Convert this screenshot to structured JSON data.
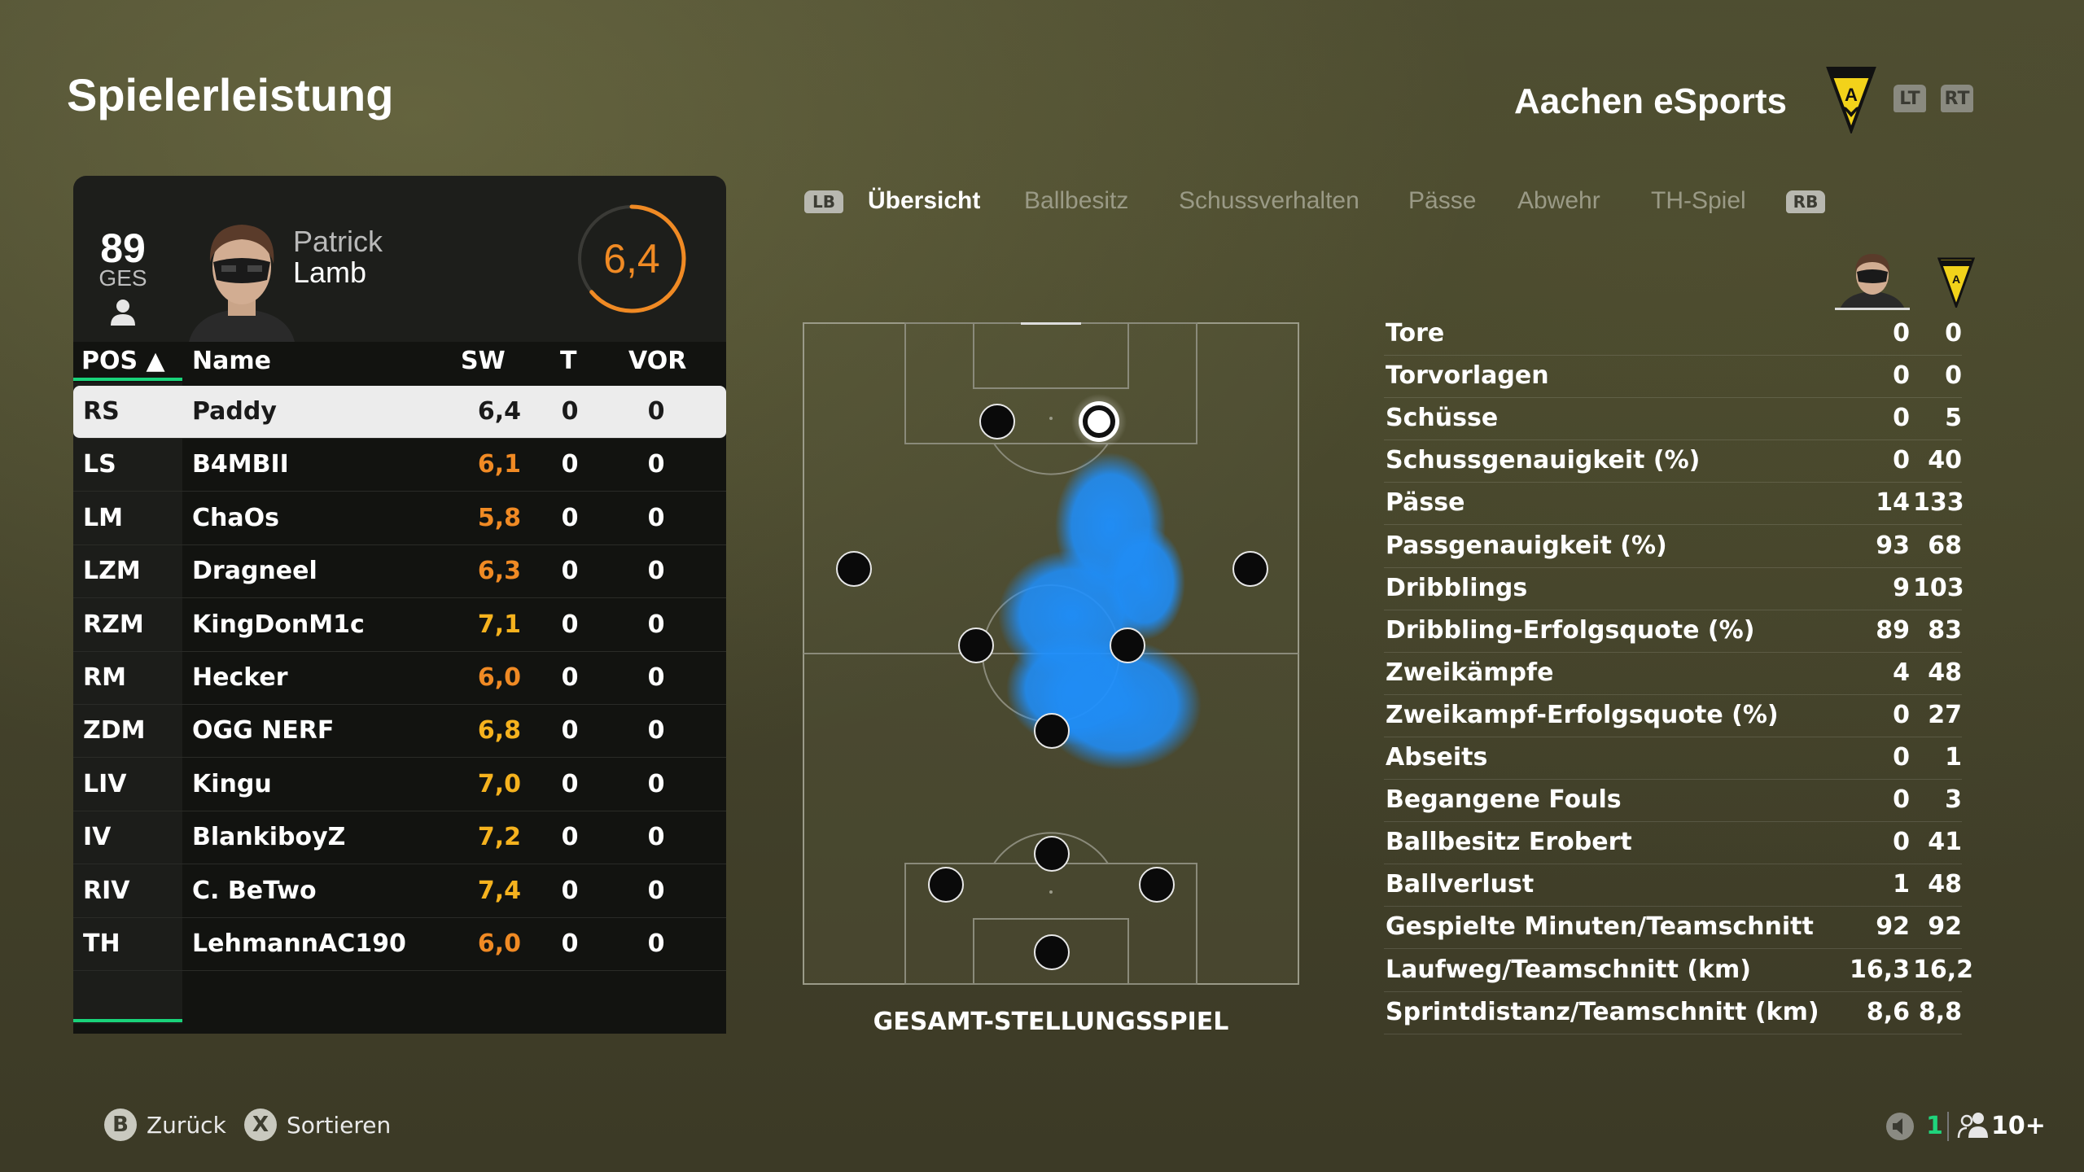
{
  "header": {
    "title": "Spielerleistung",
    "team_name": "Aachen eSports",
    "trigger_left": "LT",
    "trigger_right": "RT"
  },
  "player_card": {
    "overall": "89",
    "overall_label": "GES",
    "first_name": "Patrick",
    "last_name": "Lamb",
    "rating": "6,4"
  },
  "table": {
    "headers": {
      "pos": "POS ▲",
      "name": "Name",
      "sw": "SW",
      "t": "T",
      "vor": "VOR"
    },
    "rows": [
      {
        "pos": "RS",
        "name": "Paddy",
        "sw": "6,4",
        "t": "0",
        "vor": "0"
      },
      {
        "pos": "LS",
        "name": "B4MBII",
        "sw": "6,1",
        "t": "0",
        "vor": "0"
      },
      {
        "pos": "LM",
        "name": "ChaOs",
        "sw": "5,8",
        "t": "0",
        "vor": "0"
      },
      {
        "pos": "LZM",
        "name": "Dragneel",
        "sw": "6,3",
        "t": "0",
        "vor": "0"
      },
      {
        "pos": "RZM",
        "name": "KingDonM1c",
        "sw": "7,1",
        "t": "0",
        "vor": "0"
      },
      {
        "pos": "RM",
        "name": "Hecker",
        "sw": "6,0",
        "t": "0",
        "vor": "0"
      },
      {
        "pos": "ZDM",
        "name": "OGG NERF",
        "sw": "6,8",
        "t": "0",
        "vor": "0"
      },
      {
        "pos": "LIV",
        "name": "Kingu",
        "sw": "7,0",
        "t": "0",
        "vor": "0"
      },
      {
        "pos": "IV",
        "name": "BlankiboyZ",
        "sw": "7,2",
        "t": "0",
        "vor": "0"
      },
      {
        "pos": "RIV",
        "name": "C. BeTwo",
        "sw": "7,4",
        "t": "0",
        "vor": "0"
      },
      {
        "pos": "TH",
        "name": "LehmannAC190",
        "sw": "6,0",
        "t": "0",
        "vor": "0"
      }
    ]
  },
  "tabs": {
    "bumper_left": "LB",
    "bumper_right": "RB",
    "items": [
      "Übersicht",
      "Ballbesitz",
      "Schussverhalten",
      "Pässe",
      "Abwehr",
      "TH-Spiel"
    ],
    "active": "Übersicht"
  },
  "pitch": {
    "caption": "GESAMT-STELLUNGSSPIEL"
  },
  "stats": [
    {
      "label": "Tore",
      "player": "0",
      "team": "0"
    },
    {
      "label": "Torvorlagen",
      "player": "0",
      "team": "0"
    },
    {
      "label": "Schüsse",
      "player": "0",
      "team": "5"
    },
    {
      "label": "Schussgenauigkeit (%)",
      "player": "0",
      "team": "40"
    },
    {
      "label": "Pässe",
      "player": "14",
      "team": "133"
    },
    {
      "label": "Passgenauigkeit (%)",
      "player": "93",
      "team": "68"
    },
    {
      "label": "Dribblings",
      "player": "9",
      "team": "103"
    },
    {
      "label": "Dribbling-Erfolgsquote (%)",
      "player": "89",
      "team": "83"
    },
    {
      "label": "Zweikämpfe",
      "player": "4",
      "team": "48"
    },
    {
      "label": "Zweikampf-Erfolgsquote (%)",
      "player": "0",
      "team": "27"
    },
    {
      "label": "Abseits",
      "player": "0",
      "team": "1"
    },
    {
      "label": "Begangene Fouls",
      "player": "0",
      "team": "3"
    },
    {
      "label": "Ballbesitz Erobert",
      "player": "0",
      "team": "41"
    },
    {
      "label": "Ballverlust",
      "player": "1",
      "team": "48"
    },
    {
      "label": "Gespielte Minuten/Teamschnitt",
      "player": "92",
      "team": "92"
    },
    {
      "label": "Laufweg/Teamschnitt (km)",
      "player": "16,3",
      "team": "16,2"
    },
    {
      "label": "Sprintdistanz/Teamschnitt (km)",
      "player": "8,6",
      "team": "8,8"
    }
  ],
  "footer": {
    "back_button": "B",
    "back_label": "Zurück",
    "sort_button": "X",
    "sort_label": "Sortieren",
    "muted_count": "1",
    "party_count": "10+"
  },
  "colors": {
    "accent_green": "#19d37a",
    "rating_orange": "#f08a24",
    "rating_yellow": "#f5b21e",
    "heatmap_blue": "#1e90ff"
  }
}
